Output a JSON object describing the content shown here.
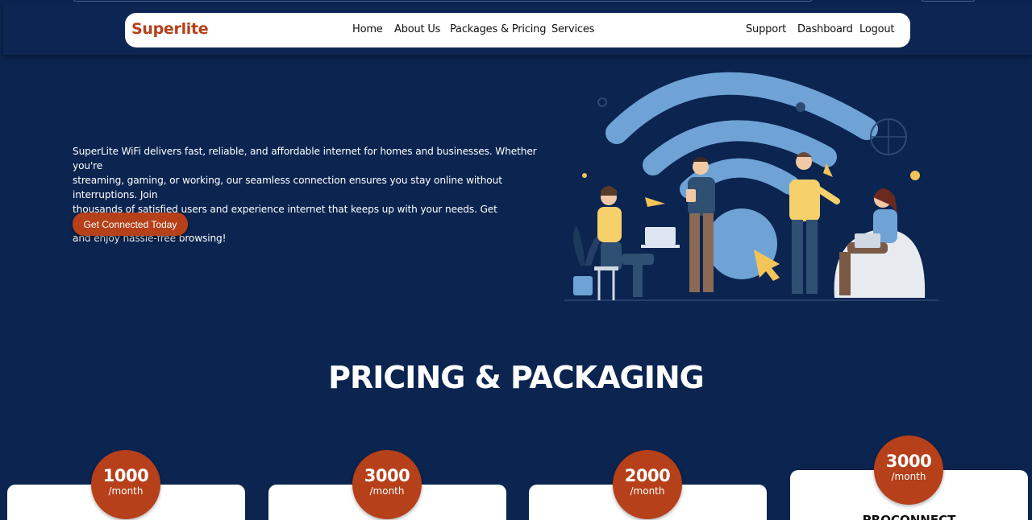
{
  "brand": {
    "name": "Superlite"
  },
  "nav": {
    "left": [
      "Home",
      "About Us",
      "Packages & Pricing",
      "Services"
    ],
    "right": [
      "Support",
      "Dashboard",
      "Logout"
    ]
  },
  "hero": {
    "line1": "SuperLite WiFi delivers fast, reliable, and affordable internet for homes and businesses. Whether you're",
    "line2": "streaming, gaming, or working, our seamless connection ensures you stay online without interruptions. Join",
    "line3": "thousands of satisfied users and experience internet that keeps up with your needs. Get connected today",
    "line4": "and enjoy hassle-free browsing!",
    "cta_label": "Get Connected Today"
  },
  "pricing": {
    "title": "PRICING & PACKAGING",
    "plans": [
      {
        "price": "1000",
        "period": "/month",
        "name": ""
      },
      {
        "price": "3000",
        "period": "/month",
        "name": ""
      },
      {
        "price": "2000",
        "period": "/month",
        "name": ""
      },
      {
        "price": "3000",
        "period": "/month",
        "name": "PROCONNECT"
      }
    ]
  },
  "colors": {
    "background": "#0b2450",
    "accent": "#b5401a",
    "wifi_blue": "#6fa3d6",
    "surface": "#ffffff"
  },
  "icons": [
    "wifi-illustration-icon"
  ]
}
